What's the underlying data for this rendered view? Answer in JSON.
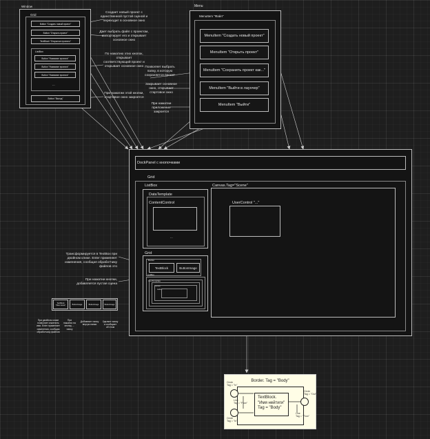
{
  "window": {
    "title": "Window",
    "grid_label": "Grid",
    "buttons": [
      "Button \"Создать новый проект\"",
      "Button \"Открыть проект\"",
      "TextBlock \"Открытые проекты\""
    ],
    "listbox_label": "ListBox",
    "list_buttons": [
      "Button \"Название проекта\"",
      "Button \"Название проекта\"",
      "Button \"Название проекта\""
    ],
    "ellipsis": "...",
    "exit_button": "Button \"Выход\""
  },
  "window_captions": [
    "Создает новый проект с\nединственной пустой сценой и\nпереходит в основное окно",
    "Дает выбрать файл с проектом,\nимпортирует его и открывает\nосновное окно",
    "По нажатию этих кнопок,\nоткрывает\nсоответствующий проект и\nоткрывает основное окно",
    "При нажатии этой кнопки,\nстартовое окно закроется"
  ],
  "menu": {
    "title": "Menu",
    "menuitem_label": "MenuItem \"Файл\"",
    "items": [
      "MenuItem \"Создать новый проект\"",
      "MenuItem \"Открыть проект\"",
      "MenuItem \"Сохранить проект как...\"",
      "MenuItem \"Выйти в лаунчер\"",
      "MenuItem \"Выйти\""
    ],
    "captions": [
      "Позволяет выбрать\nпапку, в которую\nсохраняется проект",
      "Закрывает основное\nокно, открывает\nстартовое окно",
      "При нажатии\nприложение\nзакроется"
    ]
  },
  "dockpanel": {
    "title": "DockPanel с кнопочками",
    "grid_label": "Grid",
    "listbox_label": "ListBox",
    "datatemplate_label": "DataTemplate",
    "contentcontrol_label": "ContentControl",
    "ellipsis": "...",
    "canvas_label": "Canvas.Tag=\"Scene\"",
    "usercontrol_label": "UserControl \"...\"",
    "grid2_label": "Grid",
    "border_label": "Border",
    "textblock_btn": "TextBlock",
    "buttonimage_btn": "ButtonImage",
    "listbox_small": "ListBox",
    "itemtemplate_small": "ItemTemplate",
    "border_small": "Border",
    "label_small": "Label"
  },
  "grid_captions": [
    "Трансформируется в TextBox при\nдвойном клике. Enter применяет\nизменения, сообщая обработчику\nфайлов это",
    "При нажатии кнопки,\nдобавляется пустая сцена"
  ],
  "toolbar": {
    "items": [
      "TextBlock\n\"Имя папки\"",
      "ButtonImage",
      "ButtonImage",
      "ButtonImage"
    ],
    "captions": [
      "При двойном клике\nпозволяет изменить\nимя. Enter применяет\nизменения, сообщая\nобработчику файлов",
      "При\nнажатии на\nкнопку, ...\nпапку",
      "Добавляет папку\nвнутри папки",
      "Удаляет папку\nи сообщает\nоб этом"
    ]
  },
  "legend": {
    "title": "Border. Tag = \"Body\"",
    "textblock": "TextBlock.\n\"Имя нейтиги\"\nTag = \"Body\"",
    "ann_tl": "Circle\nTag = \"In\"",
    "ann_bl": "Circle\nTag = \"In\"",
    "ann_tr": "Circle\nTag = \"Out\"",
    "ann_line_l": "Line\nTag = \"Flow\"",
    "ann_line_r": "Line\nTag = \"Flow\""
  }
}
